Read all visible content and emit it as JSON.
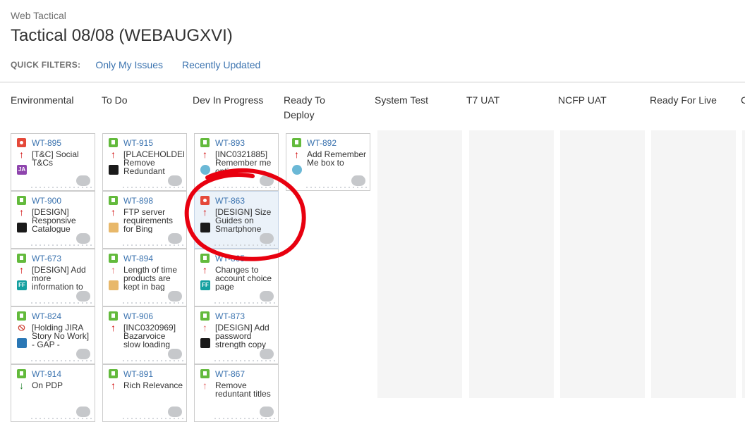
{
  "header": {
    "project": "Web Tactical",
    "title": "Tactical 08/08 (WEBAUGXVI)"
  },
  "quick_filters": {
    "label": "QUICK FILTERS:",
    "items": [
      "Only My Issues",
      "Recently Updated"
    ]
  },
  "columns": [
    "Environmental",
    "To Do",
    "Dev In Progress",
    "Ready To Deploy",
    "System Test",
    "T7 UAT",
    "NCFP UAT",
    "Ready For Live",
    "C"
  ],
  "cards": {
    "environmental": [
      {
        "key": "WT-895",
        "type": "bug-icon",
        "priority": "high-priority-icon",
        "summary": "[T&C] Social T&Cs",
        "avatar": "JA"
      },
      {
        "key": "WT-900",
        "type": "story-icon",
        "priority": "high-priority-icon",
        "summary": "[DESIGN] Responsive Catalogue",
        "avatar": "mask-avatar"
      },
      {
        "key": "WT-673",
        "type": "story-icon",
        "priority": "high-priority-icon",
        "summary": "[DESIGN] Add more information to",
        "avatar": "FF"
      },
      {
        "key": "WT-824",
        "type": "story-icon",
        "priority": "blocker-icon",
        "summary": "[Holding JIRA Story No Work] - GAP -",
        "avatar": "man-avatar"
      },
      {
        "key": "WT-914",
        "type": "story-icon",
        "priority": "low-priority-icon",
        "summary": "On PDP",
        "avatar": ""
      }
    ],
    "todo": [
      {
        "key": "WT-915",
        "type": "story-icon",
        "priority": "high-priority-icon",
        "summary": "[PLACEHOLDER] Remove Redundant",
        "avatar": "mask-avatar"
      },
      {
        "key": "WT-898",
        "type": "story-icon",
        "priority": "high-priority-icon",
        "summary": "FTP server requirements for Bing",
        "avatar": "bird-avatar"
      },
      {
        "key": "WT-894",
        "type": "story-icon",
        "priority": "medium-priority-icon",
        "summary": "Length of time products are kept in bag",
        "avatar": "bird-avatar"
      },
      {
        "key": "WT-906",
        "type": "story-icon",
        "priority": "high-priority-icon",
        "summary": "[INC0320969] Bazarvoice slow loading",
        "avatar": ""
      },
      {
        "key": "WT-891",
        "type": "story-icon",
        "priority": "high-priority-icon",
        "summary": "Rich Relevance",
        "avatar": ""
      }
    ],
    "dev": [
      {
        "key": "WT-893",
        "type": "story-icon",
        "priority": "high-priority-icon",
        "summary": "[INC0321885] Remember me option",
        "avatar": "face-avatar"
      },
      {
        "key": "WT-863",
        "type": "bug-icon",
        "priority": "high-priority-icon",
        "summary": "[DESIGN] Size Guides on Smartphone",
        "avatar": "mask-avatar"
      },
      {
        "key": "WT-865",
        "type": "story-icon",
        "priority": "high-priority-icon",
        "summary": "Changes to account choice page",
        "avatar": "FF"
      },
      {
        "key": "WT-873",
        "type": "story-icon",
        "priority": "medium-priority-icon",
        "summary": "[DESIGN] Add password strength copy",
        "avatar": "mask-avatar"
      },
      {
        "key": "WT-867",
        "type": "story-icon",
        "priority": "medium-priority-icon",
        "summary": "Remove reduntant titles",
        "avatar": ""
      }
    ],
    "deploy": [
      {
        "key": "WT-892",
        "type": "story-icon",
        "priority": "high-priority-icon",
        "summary": "Add Remember Me box to",
        "avatar": "face-avatar"
      }
    ]
  }
}
